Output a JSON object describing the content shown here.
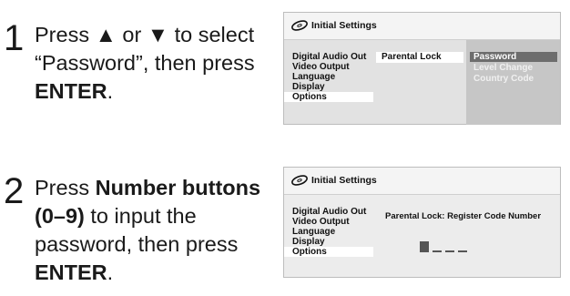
{
  "steps": [
    {
      "number": "1",
      "segments": [
        {
          "text": "Press ▲ or ▼ to select “Password”, then press ",
          "bold": false
        },
        {
          "text": "ENTER",
          "bold": true
        },
        {
          "text": ".",
          "bold": false
        }
      ]
    },
    {
      "number": "2",
      "segments": [
        {
          "text": "Press ",
          "bold": false
        },
        {
          "text": "Number buttons (0–9)",
          "bold": true
        },
        {
          "text": " to input the password, then press ",
          "bold": false
        },
        {
          "text": "ENTER",
          "bold": true
        },
        {
          "text": ".",
          "bold": false
        }
      ]
    }
  ],
  "screens": [
    {
      "header_title": "Initial Settings",
      "menu": [
        "Digital Audio Out",
        "Video Output",
        "Language",
        "Display",
        "Options"
      ],
      "selected_menu": "Options",
      "submenu": "Parental Lock",
      "options": [
        "Password",
        "Level Change",
        "Country Code"
      ],
      "selected_option": "Password"
    },
    {
      "header_title": "Initial Settings",
      "menu": [
        "Digital Audio Out",
        "Video Output",
        "Language",
        "Display",
        "Options"
      ],
      "selected_menu": "Options",
      "register_label": "Parental Lock: Register Code Number",
      "code_digits": 4,
      "active_digit": 1
    }
  ],
  "icon": "disc-icon"
}
